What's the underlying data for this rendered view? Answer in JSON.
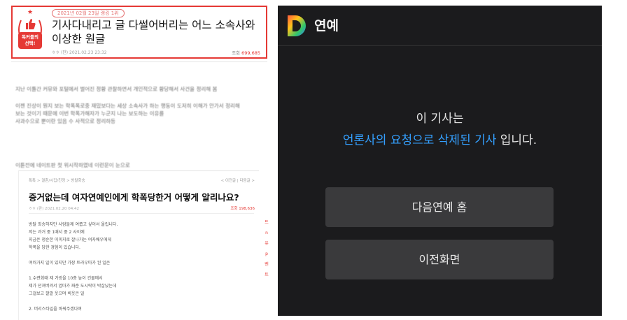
{
  "left": {
    "badge_line1": "독커들의",
    "badge_line2": "선택!",
    "date_chip": "2021년 02월 23일 랭킹 1위",
    "title": "기사다내리고 글 다썰어버리는 어느 소속사와 이상한 원글",
    "meta": "ㅎㅎ (판) 2021.02.23 23:32",
    "views_label": "조회",
    "views_value": "699,685",
    "para1": "지난 이틀간 커뮤와 포털에서 벌어진 정황 관찰하면서 개인적으로 황당해서 사건을 정리해 봄",
    "para2a": "이젠 진상이 뭔지 보는 학폭폭로중 재밌보다는 세상 소속사가 하는 행동이 도저히 이해가 안가서 정리해",
    "para2b": "보는 것이기 때문에 이번 학폭가해자가 누군지 나는 보도하는 이유를",
    "para2c": "사과수으로 뿐이란 있음 수 사적으로 정리하등",
    "para3": "이튿전에 네이트판 첫 위시작하였네 이런문이 눈으로",
    "embed": {
      "crumbs": "톡톡 > 결혼/시집/친정 > 방탈화송",
      "nav": "< 이전글 | 다음글 >",
      "title": "증거없는데 여자연예인에게 학폭당한거 어떻게 알리나요?",
      "meta": "ㅎㅎ (판) 2021.02.20 04:42",
      "views": "조회 198,636",
      "body": [
        "방탈 죄송하지만 사람들께 여쭙고 싶어서 올립니다.",
        "저는 과거 중 1때서 중 2 사이에",
        "지금은 청순한 이미지로 잘나가는 여자배우에게",
        "학폭을 당한 경험이 있습니다.",
        "",
        "여러가지 일이 있지만 가장 트라우마가 된 일은",
        "",
        "1.수련회때 제 가방을 10층 높이 건물에서",
        "제가 던져버려서 엄마가 짜준 도시락이 박살났는데",
        "그걸보고 깔깔 웃으며 비웃은 일",
        "",
        "2. 머리스타일을 바꿔주겠다며"
      ],
      "side_icons": [
        "트",
        "n",
        "유",
        "p",
        "밴",
        "트"
      ]
    }
  },
  "right": {
    "brand_icon": "daum-logo-icon",
    "section_title": "연예",
    "notice_line1": "이 기사는",
    "notice_accent": "언론사의 요청으로 삭제된 기사",
    "notice_rest": " 입니다.",
    "home_button": "다음연예 홈",
    "prev_button": "이전화면",
    "colors": {
      "background": "#1b1b1d",
      "accent": "#34a0ff",
      "button": "#3a3a3c"
    }
  }
}
